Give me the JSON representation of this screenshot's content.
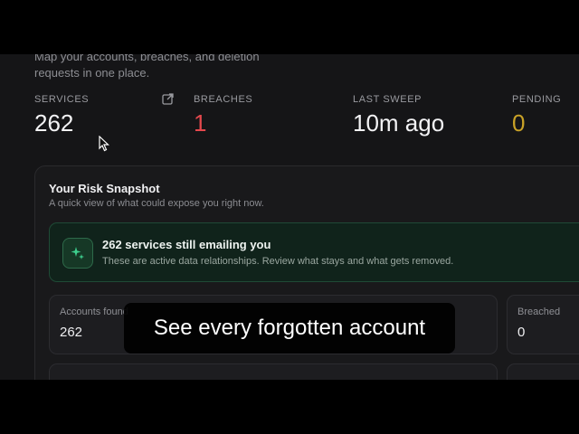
{
  "header": {
    "subtitle": "Map your accounts, breaches, and deletion requests in one place."
  },
  "stats": [
    {
      "label": "SERVICES",
      "value": "262",
      "color": "#f2f2f4"
    },
    {
      "label": "BREACHES",
      "value": "1",
      "color": "#e5484d"
    },
    {
      "label": "LAST SWEEP",
      "value": "10m ago",
      "color": "#f2f2f4"
    },
    {
      "label": "PENDING",
      "value": "0",
      "color": "#c9a227"
    }
  ],
  "snapshot": {
    "title": "Your Risk Snapshot",
    "subtitle": "A quick view of what could expose you right now.",
    "alert": {
      "title": "262 services still emailing you",
      "description": "These are active data relationships. Review what stays and what gets removed.",
      "icon": "sparkle-icon"
    },
    "tiles": [
      {
        "label": "Accounts found",
        "value": "262"
      },
      {
        "label": "Breached",
        "value": "0"
      }
    ]
  },
  "caption": "See every forgotten account",
  "colors": {
    "accent_green": "#3ecf8e",
    "danger": "#e5484d",
    "warning": "#c9a227"
  }
}
